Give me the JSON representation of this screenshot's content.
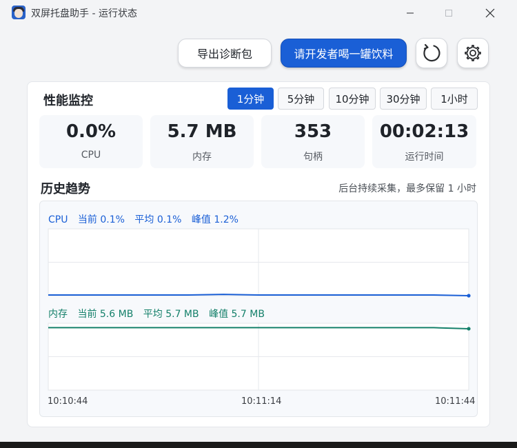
{
  "window": {
    "title": "双屏托盘助手 - 运行状态"
  },
  "toolbar": {
    "export_label": "导出诊断包",
    "donate_label": "请开发者喝一罐饮料"
  },
  "performance": {
    "title": "性能监控",
    "ranges": [
      {
        "label": "1分钟",
        "active": true
      },
      {
        "label": "5分钟",
        "active": false
      },
      {
        "label": "10分钟",
        "active": false
      },
      {
        "label": "30分钟",
        "active": false
      },
      {
        "label": "1小时",
        "active": false
      }
    ],
    "stats": [
      {
        "value": "0.0%",
        "label": "CPU"
      },
      {
        "value": "5.7 MB",
        "label": "内存"
      },
      {
        "value": "353",
        "label": "句柄"
      },
      {
        "value": "00:02:13",
        "label": "运行时间"
      }
    ]
  },
  "history": {
    "title": "历史趋势",
    "note": "后台持续采集，最多保留 1 小时"
  },
  "colors": {
    "accent": "#1a5fd6",
    "cpu_line": "#1a5fd6",
    "mem_line": "#14806a"
  },
  "chart_data": [
    {
      "type": "line",
      "title": "",
      "series": [
        {
          "name": "CPU",
          "x": [
            "10:10:44",
            "10:10:49",
            "10:10:54",
            "10:10:59",
            "10:11:04",
            "10:11:09",
            "10:11:14",
            "10:11:19",
            "10:11:24",
            "10:11:29",
            "10:11:34",
            "10:11:39",
            "10:11:44"
          ],
          "values": [
            0.1,
            0.1,
            0.1,
            0.1,
            0.1,
            0.2,
            0.1,
            0.1,
            0.1,
            0.1,
            0.1,
            0.1,
            0.0
          ]
        }
      ],
      "legend_text": {
        "name": "CPU",
        "current": "当前 0.1%",
        "avg": "平均 0.1%",
        "peak": "峰值 1.2%"
      },
      "ylim": [
        0,
        10
      ],
      "grid": true
    },
    {
      "type": "line",
      "title": "",
      "series": [
        {
          "name": "内存",
          "x": [
            "10:10:44",
            "10:10:49",
            "10:10:54",
            "10:10:59",
            "10:11:04",
            "10:11:09",
            "10:11:14",
            "10:11:19",
            "10:11:24",
            "10:11:29",
            "10:11:34",
            "10:11:39",
            "10:11:44"
          ],
          "values": [
            5.7,
            5.7,
            5.7,
            5.7,
            5.7,
            5.7,
            5.7,
            5.7,
            5.7,
            5.7,
            5.7,
            5.7,
            5.6
          ]
        }
      ],
      "legend_text": {
        "name": "内存",
        "current": "当前 5.6 MB",
        "avg": "平均 5.7 MB",
        "peak": "峰值 5.7 MB"
      },
      "ylim": [
        0,
        6.1
      ],
      "grid": true
    }
  ],
  "x_ticks": [
    "10:10:44",
    "10:11:14",
    "10:11:44"
  ]
}
